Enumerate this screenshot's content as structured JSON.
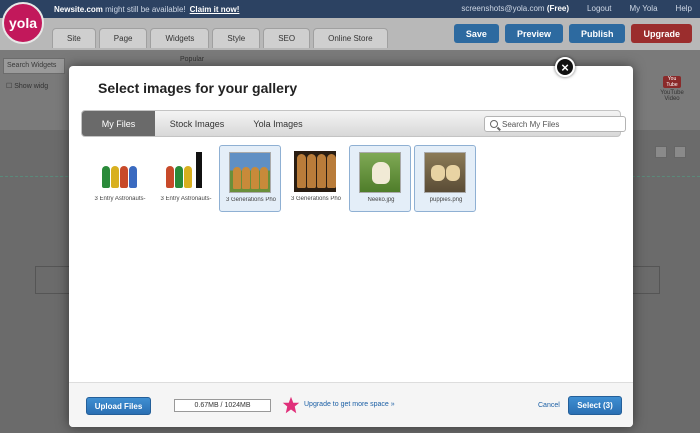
{
  "topbar": {
    "domain": "Newsite.com",
    "availability": "might still be available!",
    "claim_link": "Claim it now!",
    "account": "screenshots@yola.com",
    "plan": "(Free)",
    "logout": "Logout",
    "my_yola": "My Yola",
    "help": "Help"
  },
  "logo": {
    "text": "yola"
  },
  "editor_tabs": [
    "Site",
    "Page",
    "Widgets",
    "Style",
    "SEO",
    "Online Store"
  ],
  "editor_actions": {
    "save": "Save",
    "preview": "Preview",
    "publish": "Publish",
    "upgrade": "Upgrade"
  },
  "sidebar": {
    "search_placeholder": "Search Widgets",
    "show_label": "Show widg",
    "popular_label": "Popular"
  },
  "youtube_widget": {
    "icon_text": "You Tube",
    "label": "YouTube Video"
  },
  "modal": {
    "title": "Select images for your gallery",
    "close_glyph": "×",
    "tabs": [
      {
        "label": "My Files",
        "active": true
      },
      {
        "label": "Stock Images",
        "active": false
      },
      {
        "label": "Yola Images",
        "active": false
      }
    ],
    "search_placeholder": "Search My Files",
    "files": [
      {
        "caption": "3 Entry Astronauts-",
        "selected": false,
        "art": "astronauts"
      },
      {
        "caption": "3 Entry Astronauts-",
        "selected": false,
        "art": "astronauts-2"
      },
      {
        "caption": "3 Generations Pho",
        "selected": true,
        "art": "golden-retrievers"
      },
      {
        "caption": "3 Generations Pho",
        "selected": false,
        "art": "golden-retrievers-2"
      },
      {
        "caption": "Neeko.jpg",
        "selected": true,
        "art": "white-dog"
      },
      {
        "caption": "puppies.png",
        "selected": true,
        "art": "puppies"
      }
    ],
    "footer": {
      "upload_label": "Upload Files",
      "usage": "0.67MB / 1024MB",
      "upgrade_link": "Upgrade to get more space »",
      "cancel_label": "Cancel",
      "select_label": "Select (3)"
    }
  },
  "colors": {
    "accent_blue": "#2a6fb3",
    "brand_pink": "#c2185b",
    "upgrade_red": "#9b2d2d",
    "star_pink": "#e0307a"
  }
}
